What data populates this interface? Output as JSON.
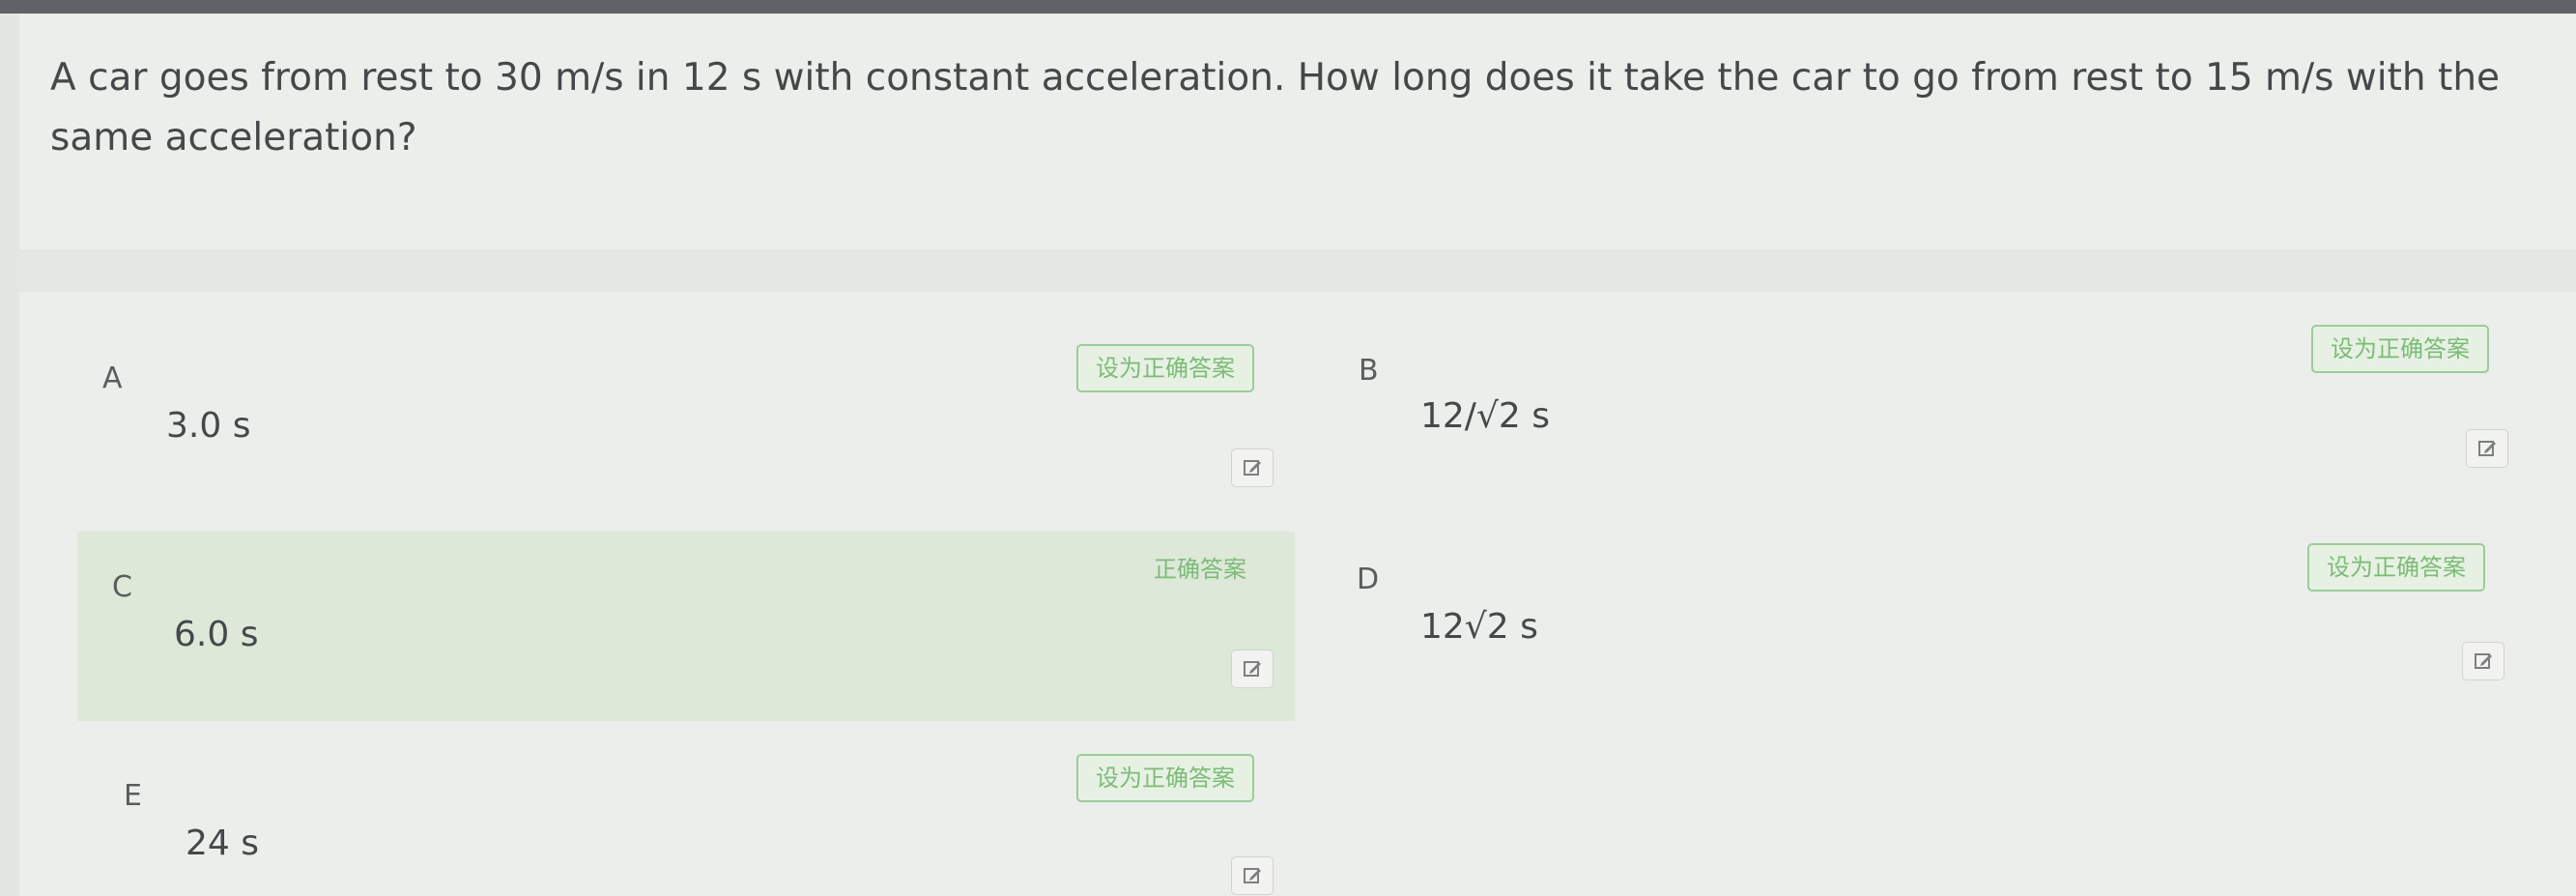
{
  "question": {
    "text": "A car goes from rest to 30 m/s in 12 s with constant acceleration. How long does it take the car to go from rest to 15 m/s with the same acceleration?"
  },
  "options": [
    {
      "letter": "A",
      "value": "3.0 s",
      "button_label": "设为正确答案",
      "is_correct": false
    },
    {
      "letter": "B",
      "value": "12/√2 s",
      "button_label": "设为正确答案",
      "is_correct": false
    },
    {
      "letter": "C",
      "value": "6.0 s",
      "button_label": "正确答案",
      "is_correct": true
    },
    {
      "letter": "D",
      "value": "12√2 s",
      "button_label": "设为正确答案",
      "is_correct": false
    },
    {
      "letter": "E",
      "value": "24 s",
      "button_label": "设为正确答案",
      "is_correct": false
    }
  ],
  "colors": {
    "correct_bg": "#dde8d9",
    "button_border": "#9ccc9a",
    "button_text": "#7dbb78",
    "background": "#eceeeb"
  },
  "icons": {
    "edit": "edit-icon"
  }
}
